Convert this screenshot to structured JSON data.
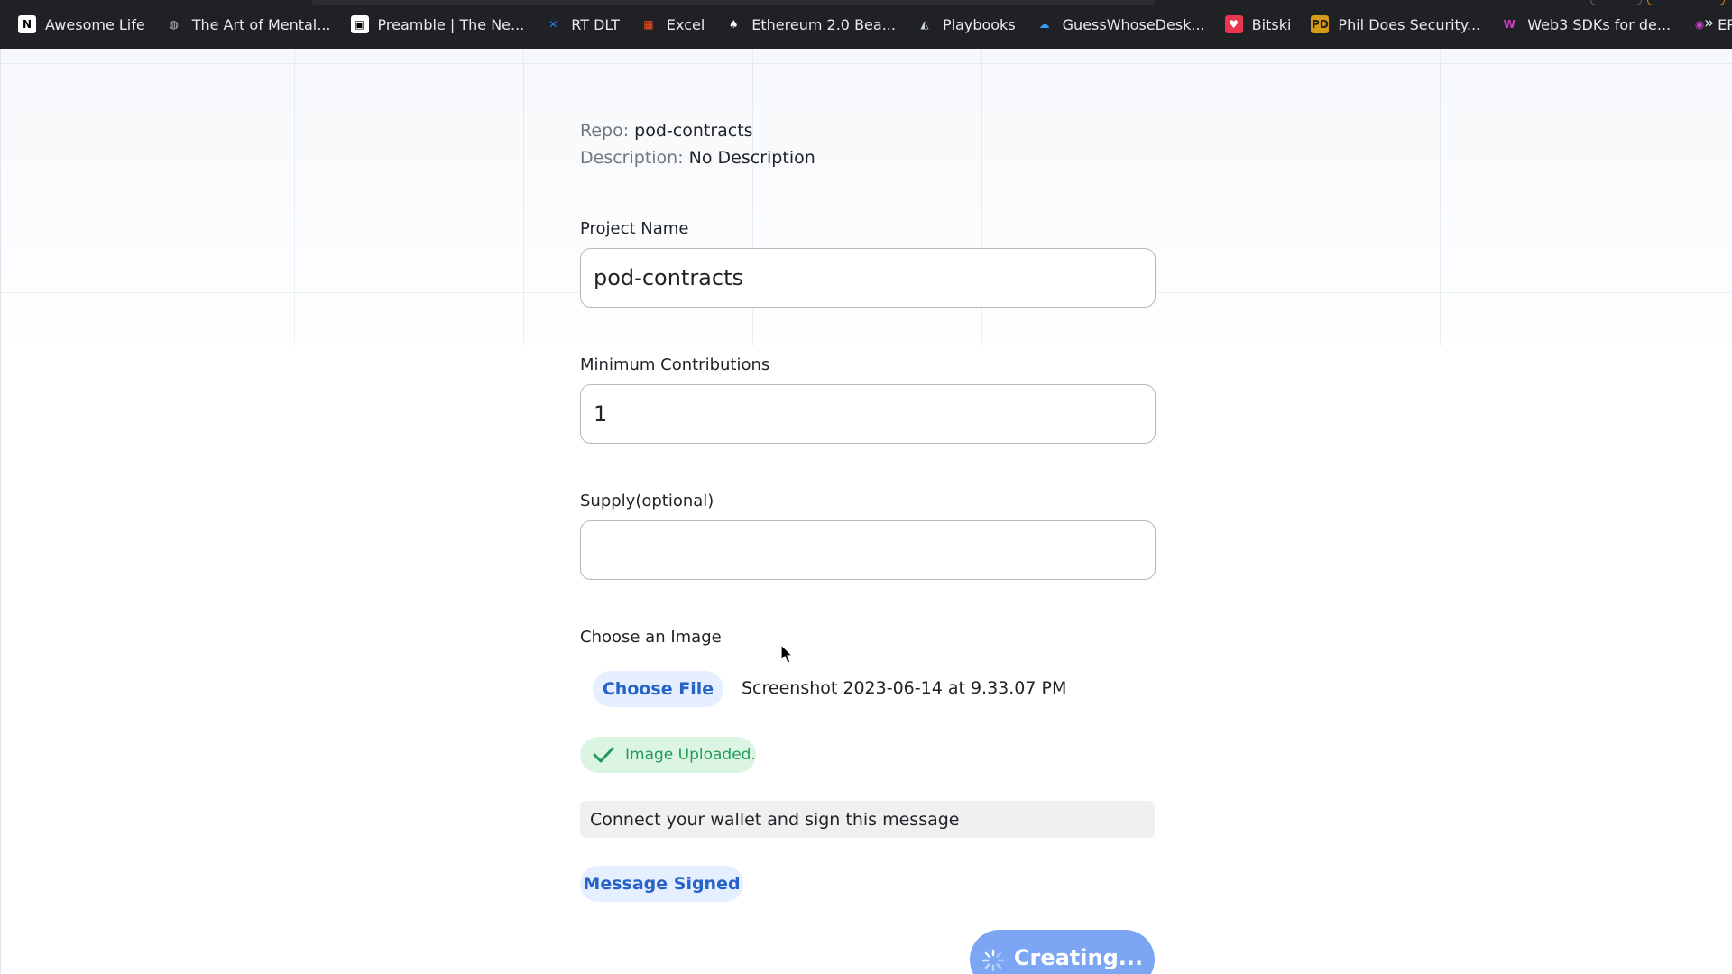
{
  "bookmarks": [
    {
      "label": "Awesome Life",
      "icon": "notion-icon",
      "glyph": "N",
      "bg": "#ffffff",
      "fg": "#000000"
    },
    {
      "label": "The Art of Mental...",
      "icon": "globe-icon",
      "glyph": "◍",
      "bg": "transparent",
      "fg": "#bdc1c6"
    },
    {
      "label": "Preamble | The Ne...",
      "icon": "preamble-icon",
      "glyph": "▣",
      "bg": "#ffffff",
      "fg": "#000000"
    },
    {
      "label": "RT DLT",
      "icon": "confluence-icon",
      "glyph": "✕",
      "bg": "transparent",
      "fg": "#2684ff"
    },
    {
      "label": "Excel",
      "icon": "microsoft-icon",
      "glyph": "▦",
      "bg": "transparent",
      "fg": "#f25022"
    },
    {
      "label": "Ethereum 2.0 Bea...",
      "icon": "ethereum-icon",
      "glyph": "♠",
      "bg": "transparent",
      "fg": "#ffffff"
    },
    {
      "label": "Playbooks",
      "icon": "playbooks-icon",
      "glyph": "◭",
      "bg": "transparent",
      "fg": "#d0d4dc"
    },
    {
      "label": "GuessWhoseDesk...",
      "icon": "onedrive-icon",
      "glyph": "☁",
      "bg": "transparent",
      "fg": "#3a9bf0"
    },
    {
      "label": "Bitski",
      "icon": "bitski-icon",
      "glyph": "♥",
      "bg": "#e8364f",
      "fg": "#ffffff"
    },
    {
      "label": "Phil Does Security...",
      "icon": "pds-icon",
      "glyph": "PD",
      "bg": "#d49a1a",
      "fg": "#202124"
    },
    {
      "label": "Web3 SDKs for de...",
      "icon": "web3-icon",
      "glyph": "W",
      "bg": "transparent",
      "fg": "#d43acb"
    },
    {
      "label": "EPNS Home",
      "icon": "epns-bell-icon",
      "glyph": "◉",
      "bg": "transparent",
      "fg": "#cf3bd0"
    }
  ],
  "bookmarks_more": "»",
  "repo": {
    "key": "Repo:",
    "value": "pod-contracts"
  },
  "description": {
    "key": "Description:",
    "value": "No Description"
  },
  "project_name": {
    "label": "Project Name",
    "value": "pod-contracts"
  },
  "min_contributions": {
    "label": "Minimum Contributions",
    "value": "1"
  },
  "supply": {
    "label": "Supply(optional)",
    "value": ""
  },
  "image": {
    "label": "Choose an Image",
    "choose_label": "Choose File",
    "file_name": "Screenshot 2023-06-14 at 9.33.07 PM",
    "uploaded_label": "Image Uploaded."
  },
  "sign_message": "Connect your wallet and sign this message",
  "signed_label": "Message Signed",
  "submit_label": "Creating...",
  "colors": {
    "accent": "#2563c9",
    "success": "#1f9d55",
    "button_bg": "#7ca6f4"
  }
}
